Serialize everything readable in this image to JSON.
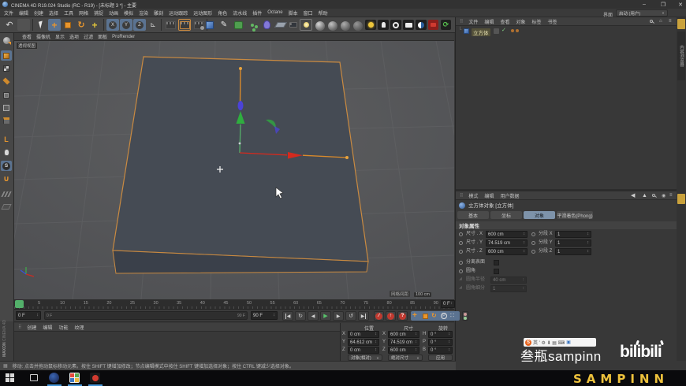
{
  "window": {
    "title": "CINEMA 4D R19.024 Studio (RC - R19) - [未标题 3 *] - 主要",
    "minimize": "–",
    "maximize": "❐",
    "close": "✕"
  },
  "menubar": {
    "items": [
      "文件",
      "编辑",
      "创建",
      "选择",
      "工具",
      "网格",
      "捕捉",
      "动画",
      "模拟",
      "渲染",
      "雕刻",
      "运动跟踪",
      "运动图形",
      "角色",
      "流水线",
      "插件",
      "Octane",
      "脚本",
      "窗口",
      "帮助"
    ]
  },
  "interface": {
    "label": "界面",
    "value": "启动 (用户)"
  },
  "viewport": {
    "menu": [
      "查看",
      "摄像机",
      "显示",
      "选项",
      "过滤",
      "面板",
      "ProRender"
    ],
    "view_label": "透视视图",
    "grid_label": "网格间距",
    "grid_value": "100 cm"
  },
  "object_manager": {
    "menu": [
      "文件",
      "编辑",
      "查看",
      "对象",
      "标签",
      "书签"
    ],
    "object_name": "立方体"
  },
  "attribute_manager": {
    "menu": [
      "模式",
      "编辑",
      "用户数据"
    ],
    "title": "立方体对象 [立方体]",
    "tabs": [
      "基本",
      "坐标",
      "对象",
      "平滑着色(Phong)"
    ],
    "section": "对象属性",
    "rows": [
      {
        "label": "尺寸 . X",
        "value": "600 cm",
        "label2": "分段 X",
        "value2": "1"
      },
      {
        "label": "尺寸 . Y",
        "value": "74.519 cm",
        "label2": "分段 Y",
        "value2": "1"
      },
      {
        "label": "尺寸 . Z",
        "value": "600 cm",
        "label2": "分段 Z",
        "value2": "1"
      }
    ],
    "check_rows": [
      {
        "label": "分离表面"
      },
      {
        "label": "圆角"
      }
    ],
    "disabled_rows": [
      {
        "label": "圆角半径",
        "value": "40 cm"
      },
      {
        "label": "圆角细分",
        "value": "1"
      }
    ]
  },
  "timeline": {
    "ticks": [
      "5",
      "10",
      "15",
      "20",
      "25",
      "30",
      "35",
      "40",
      "45",
      "50",
      "55",
      "60",
      "65",
      "70",
      "75",
      "80",
      "85",
      "90"
    ],
    "current": "0 F",
    "range_start": "0 F",
    "range_end": "90 F",
    "end_field": "90 F",
    "increment": "0 F"
  },
  "material_manager": {
    "menu": [
      "创建",
      "编辑",
      "功能",
      "纹理"
    ]
  },
  "coordinate_manager": {
    "headers": [
      "位置",
      "尺寸",
      "旋转"
    ],
    "pos": {
      "xl": "X",
      "x": "0 cm",
      "yl": "Y",
      "y": "64.612 cm",
      "zl": "Z",
      "z": "0 cm"
    },
    "size": {
      "xl": "X",
      "x": "600 cm",
      "yl": "Y",
      "y": "74.519 cm",
      "zl": "Z",
      "z": "600 cm"
    },
    "rot": {
      "hl": "H",
      "h": "0 °",
      "pl": "P",
      "p": "0 °",
      "bl": "B",
      "b": "0 °"
    },
    "mode_dropdown": "对象(相对)",
    "size_dropdown": "绝对尺寸",
    "apply": "应用"
  },
  "statusbar": {
    "text": "移动: 点击并拖动鼠标移动元素。按住 SHIFT 键增加修改；节点编辑模式中按住 SHIFT 键增加选择对象；按住 CTRL 键减少选择对象。"
  },
  "branding": {
    "maxon": "MAXON",
    "cinema": "CINEMA 4D"
  },
  "rstrip": {
    "tab": "内容浏览器"
  },
  "watermark": {
    "name": "叁瓶sampinn",
    "logo": "bilibili",
    "caption": "SAMPINN",
    "ime": "S"
  }
}
